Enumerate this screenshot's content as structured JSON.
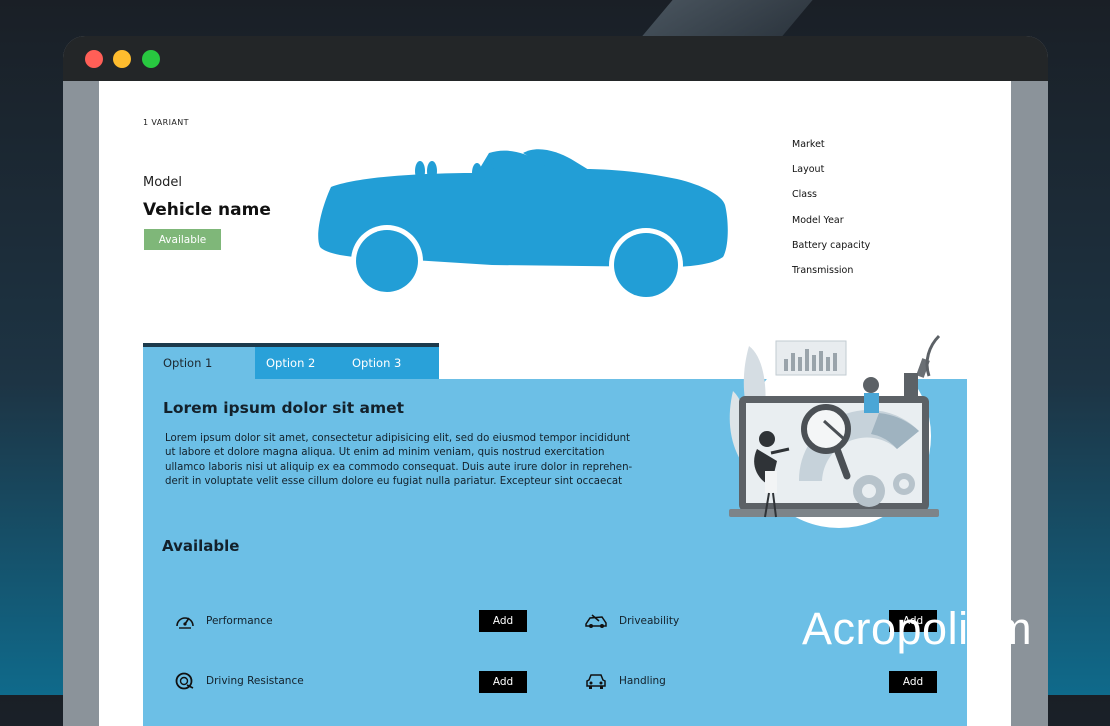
{
  "page": {
    "variant_count": "1 VARIANT",
    "model_label": "Model",
    "vehicle_name": "Vehicle name",
    "status_badge": "Available"
  },
  "specs": [
    "Market",
    "Layout",
    "Class",
    "Model Year",
    "Battery capacity",
    "Transmission"
  ],
  "tabs": [
    {
      "label": "Option 1",
      "active": true
    },
    {
      "label": "Option 2",
      "active": false
    },
    {
      "label": "Option 3",
      "active": false
    }
  ],
  "content": {
    "heading": "Lorem ipsum dolor sit amet",
    "paragraph_lines": [
      "Lorem ipsum dolor sit amet, consectetur adipisicing elit, sed do eiusmod tempor incididunt",
      "ut labore et dolore magna aliqua. Ut enim ad minim veniam, quis nostrud exercitation",
      "ullamco laboris nisi ut aliquip ex ea commodo consequat. Duis aute irure dolor in reprehen-",
      "derit in voluptate velit esse cillum dolore eu fugiat nulla pariatur. Excepteur sint occaecat"
    ],
    "available_heading": "Available"
  },
  "features": [
    {
      "label": "Performance",
      "icon": "speedometer-icon",
      "button": "Add"
    },
    {
      "label": "Driveability",
      "icon": "steering-car-icon",
      "button": "Add"
    },
    {
      "label": "Driving Resistance",
      "icon": "tire-icon",
      "button": "Add"
    },
    {
      "label": "Handling",
      "icon": "car-front-icon",
      "button": "Add"
    }
  ],
  "watermark": {
    "brand": "Acropolium"
  },
  "colors": {
    "accent_blue": "#29a1d9",
    "panel_blue": "#6cbfe6",
    "car_blue": "#229ed6",
    "badge_green": "#7fb779"
  }
}
